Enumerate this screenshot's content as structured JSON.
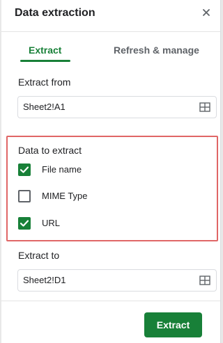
{
  "panel": {
    "title": "Data extraction"
  },
  "tabs": [
    {
      "label": "Extract",
      "active": true
    },
    {
      "label": "Refresh & manage",
      "active": false
    }
  ],
  "extract_from": {
    "label": "Extract from",
    "value": "Sheet2!A1"
  },
  "data_to_extract": {
    "label": "Data to extract",
    "options": [
      {
        "label": "File name",
        "checked": true
      },
      {
        "label": "MIME Type",
        "checked": false
      },
      {
        "label": "URL",
        "checked": true
      }
    ]
  },
  "extract_to": {
    "label": "Extract to",
    "value": "Sheet2!D1"
  },
  "footer": {
    "button_label": "Extract"
  },
  "colors": {
    "accent": "#188038",
    "highlight_border": "#e06666"
  },
  "icons": {
    "close": "close-icon",
    "range_picker": "grid-icon"
  }
}
